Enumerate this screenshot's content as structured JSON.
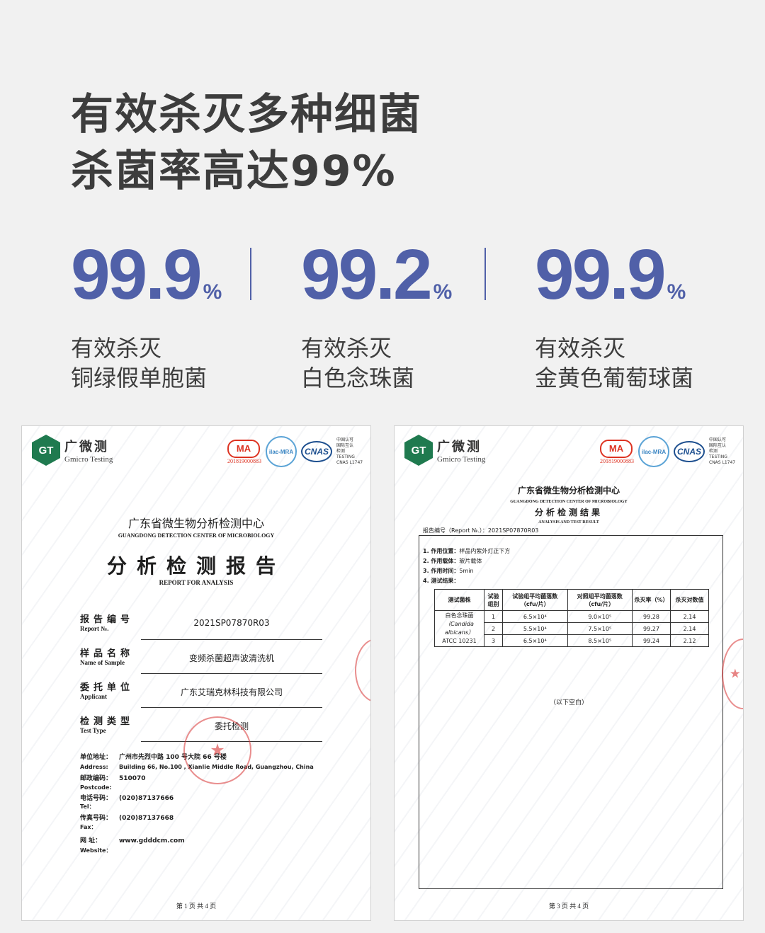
{
  "headline": {
    "line1": "有效杀灭多种细菌",
    "line2": "杀菌率高达99%"
  },
  "stats": [
    {
      "value": "99.9",
      "unit": "%",
      "line1": "有效杀灭",
      "line2": "铜绿假单胞菌"
    },
    {
      "value": "99.2",
      "unit": "%",
      "line1": "有效杀灭",
      "line2": "白色念珠菌"
    },
    {
      "value": "99.9",
      "unit": "%",
      "line1": "有效杀灭",
      "line2": "金黄色葡萄球菌"
    }
  ],
  "doc1": {
    "logo_icon": "GT",
    "logo_cn": "广微测",
    "logo_en": "Gmicro Testing",
    "cma": "MA",
    "cma_number": "201819000883",
    "ilac": "ilac-MRA",
    "cnas": "CNAS",
    "cnas_text": [
      "中国认可",
      "国际互认",
      "检测",
      "TESTING",
      "CNAS L1747"
    ],
    "org_cn": "广东省微生物分析检测中心",
    "org_en": "GUANGDONG  DETECTION  CENTER  OF  MICROBIOLOGY",
    "title_cn": "分析检测报告",
    "title_en": "REPORT   FOR   ANALYSIS",
    "fields": [
      {
        "label": "报告编号",
        "label_en": "Report №.",
        "value": "2021SP07870R03"
      },
      {
        "label": "样品名称",
        "label_en": "Name of Sample",
        "value": "变频杀菌超声波清洗机"
      },
      {
        "label": "委托单位",
        "label_en": "Applicant",
        "value": "广东艾瑞克林科技有限公司"
      },
      {
        "label": "检测类型",
        "label_en": "Test Type",
        "value": "委托检测"
      }
    ],
    "address": [
      {
        "k": "单位地址：",
        "v": "广州市先烈中路 100 号大院 66 号楼"
      },
      {
        "k": "Address:",
        "v": "Building 66, No.100 , Xianlie Middle Road, Guangzhou, China"
      },
      {
        "k": "邮政编码：",
        "v": "510070"
      },
      {
        "k": "Postcode:",
        "v": ""
      },
      {
        "k": "电话号码：",
        "v": "(020)87137666"
      },
      {
        "k": "Tel：",
        "v": ""
      },
      {
        "k": "传真号码：",
        "v": "(020)87137668"
      },
      {
        "k": "Fax：",
        "v": ""
      },
      {
        "k": "网    址：",
        "v": "www.gdddcm.com"
      },
      {
        "k": "Website：",
        "v": ""
      }
    ],
    "footer": "第 1 页 共 4 页"
  },
  "doc2": {
    "logo_icon": "GT",
    "logo_cn": "广微测",
    "logo_en": "Gmicro Testing",
    "cma": "MA",
    "cma_number": "201819000883",
    "ilac": "ilac-MRA",
    "cnas": "CNAS",
    "cnas_text": [
      "中国认可",
      "国际互认",
      "检测",
      "TESTING",
      "CNAS L1747"
    ],
    "org_cn": "广东省微生物分析检测中心",
    "org_en": "GUANGDONG  DETECTION  CENTER  OF  MICROBIOLOGY",
    "title_cn": "分析检测结果",
    "title_en": "ANALYSIS AND TEST RESULT",
    "report_no": "报告编号（Report №.）：2021SP07870R03",
    "items": [
      {
        "k": "1. 作用位置：",
        "v": "样品内紫外灯正下方"
      },
      {
        "k": "2. 作用载体：",
        "v": "玻片载体"
      },
      {
        "k": "3. 作用时间：",
        "v": "5min"
      },
      {
        "k": "4. 测试结果：",
        "v": ""
      }
    ],
    "table": {
      "headers": [
        "测试菌株",
        "试验组别",
        "试验组平均菌落数（cfu/片）",
        "对照组平均菌落数（cfu/片）",
        "杀灭率（%）",
        "杀灭对数值"
      ],
      "strain": [
        "白色念珠菌",
        "（Candida albicans）",
        "ATCC 10231"
      ],
      "rows": [
        [
          "1",
          "6.5×10⁴",
          "9.0×10⁵",
          "99.28",
          "2.14"
        ],
        [
          "2",
          "5.5×10⁴",
          "7.5×10⁵",
          "99.27",
          "2.14"
        ],
        [
          "3",
          "6.5×10⁴",
          "8.5×10⁵",
          "99.24",
          "2.12"
        ]
      ]
    },
    "blank": "（以下空白）",
    "footer": "第 3 页 共 4 页"
  }
}
